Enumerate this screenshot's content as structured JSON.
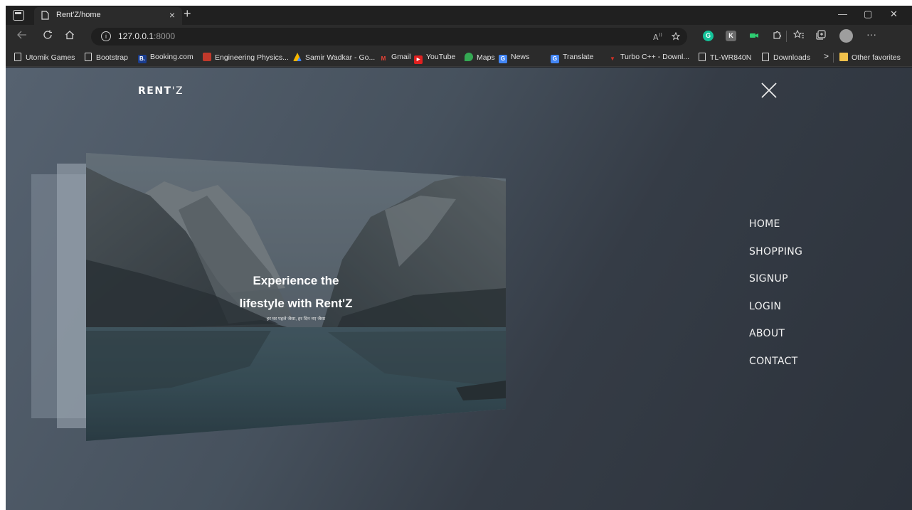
{
  "browser": {
    "tab": {
      "title": "Rent'Z/home",
      "close_glyph": "×"
    },
    "new_tab_glyph": "+",
    "window_controls": {
      "minimize": "—",
      "restore": "▢",
      "close": "✕"
    },
    "address": {
      "host": "127.0.0.1",
      "port": ":8000",
      "info_glyph": "i"
    },
    "toolbar_icons": [
      "back-icon",
      "refresh-icon",
      "home-icon",
      "read-aloud-icon",
      "favorite-add-icon",
      "favorites-icon",
      "collections-icon",
      "profile-icon",
      "more-icon"
    ],
    "extensions": [
      {
        "name": "grammarly-icon",
        "letter": "G",
        "color": "#15c39a"
      },
      {
        "name": "extension-k-icon",
        "letter": "K",
        "color": "#6b6b6b"
      },
      {
        "name": "extension-camera-icon",
        "letter": "",
        "color": "#3a3a3a"
      }
    ],
    "bookmarks": [
      {
        "label": "Utomik Games",
        "icon": "page-icon"
      },
      {
        "label": "Bootstrap",
        "icon": "page-icon"
      },
      {
        "label": "Booking.com",
        "icon": "booking-icon",
        "letter": "B.",
        "color": "#1a3d8f"
      },
      {
        "label": "Engineering Physics...",
        "icon": "nptel-icon",
        "letter": "",
        "color": "#c0392b"
      },
      {
        "label": "Samir Wadkar - Go...",
        "icon": "google-drive-icon",
        "letter": "",
        "color": "#f4b400"
      },
      {
        "label": "Gmail",
        "icon": "gmail-icon",
        "letter": "M",
        "color": "#2b2b2b"
      },
      {
        "label": "YouTube",
        "icon": "youtube-icon",
        "letter": "▶",
        "color": "#e02020"
      },
      {
        "label": "Maps",
        "icon": "maps-icon",
        "letter": "",
        "color": "#34a853"
      },
      {
        "label": "News",
        "icon": "news-icon",
        "letter": "G",
        "color": "#4285f4"
      },
      {
        "label": "Translate",
        "icon": "translate-icon",
        "letter": "G",
        "color": "#4285f4"
      },
      {
        "label": "Turbo C++ - Downl...",
        "icon": "turbo-icon",
        "letter": "▼",
        "color": "#d93025"
      },
      {
        "label": "TL-WR840N",
        "icon": "page-icon"
      },
      {
        "label": "Downloads",
        "icon": "page-icon"
      }
    ],
    "more_bookmarks_glyph": ">",
    "other_favorites": "Other favorites"
  },
  "page": {
    "brand": {
      "bold": "RENT",
      "rest": "'Z"
    },
    "hero": {
      "title_line1": "Experience the",
      "title_line2": "lifestyle with Rent'Z",
      "subtitle": "हर घर पहले जैसा, हर दिन नए जैसा"
    },
    "nav": [
      "HOME",
      "SHOPPING",
      "SIGNUP",
      "LOGIN",
      "ABOUT",
      "CONTACT"
    ],
    "colors": {
      "background_start": "#566270",
      "background_end": "#2c323b",
      "text": "#ffffff"
    }
  }
}
